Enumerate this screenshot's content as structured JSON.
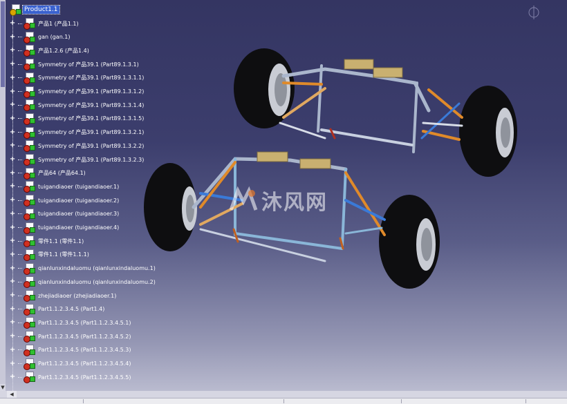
{
  "tree": {
    "root": "Product1.1",
    "items": [
      "产品1 (产品1.1)",
      "gan (gan.1)",
      "产品1.2.6 (产品1.4)",
      "Symmetry of 产品39.1 (Part89.1.3.1)",
      "Symmetry of 产品39.1 (Part89.1.3.1.1)",
      "Symmetry of 产品39.1 (Part89.1.3.1.2)",
      "Symmetry of 产品39.1 (Part89.1.3.1.4)",
      "Symmetry of 产品39.1 (Part89.1.3.1.5)",
      "Symmetry of 产品39.1 (Part89.1.3.2.1)",
      "Symmetry of 产品39.1 (Part89.1.3.2.2)",
      "Symmetry of 产品39.1 (Part89.1.3.2.3)",
      "产品64 (产品64.1)",
      "tuigandiaoer (tuigandiaoer.1)",
      "tuigandiaoer (tuigandiaoer.2)",
      "tuigandiaoer (tuigandiaoer.3)",
      "tuigandiaoer (tuigandiaoer.4)",
      "零件1.1 (零件1.1)",
      "零件1.1 (零件1.1.1)",
      "qianlunxindaluomu (qianlunxindaluomu.1)",
      "qianlunxindaluomu (qianlunxindaluomu.2)",
      "zhejiadiaoer (zhejiadiaoer.1)",
      "Part1.1.2.3.4.5 (Part1.4)",
      "Part1.1.2.3.4.5 (Part1.1.2.3.4.5.1)",
      "Part1.1.2.3.4.5 (Part1.1.2.3.4.5.2)",
      "Part1.1.2.3.4.5 (Part1.1.2.3.4.5.3)",
      "Part1.1.2.3.4.5 (Part1.1.2.3.4.5.4)",
      "Part1.1.2.3.4.5 (Part1.1.2.3.4.5.5)"
    ],
    "expander_glyph": "+"
  },
  "watermark": {
    "text": "沐风网"
  },
  "icons": {
    "part": "part-gear-icon",
    "product": "product-gear-icon",
    "compass": "compass-icon"
  },
  "colors": {
    "background_top": "#343562",
    "background_bottom": "#c3c4d6",
    "selection": "#3a62d0",
    "tire": "#0e0e10",
    "frame_steel": "#aab6cc",
    "arm_orange": "#e08a2a",
    "arm_blue": "#3a7ad8"
  }
}
